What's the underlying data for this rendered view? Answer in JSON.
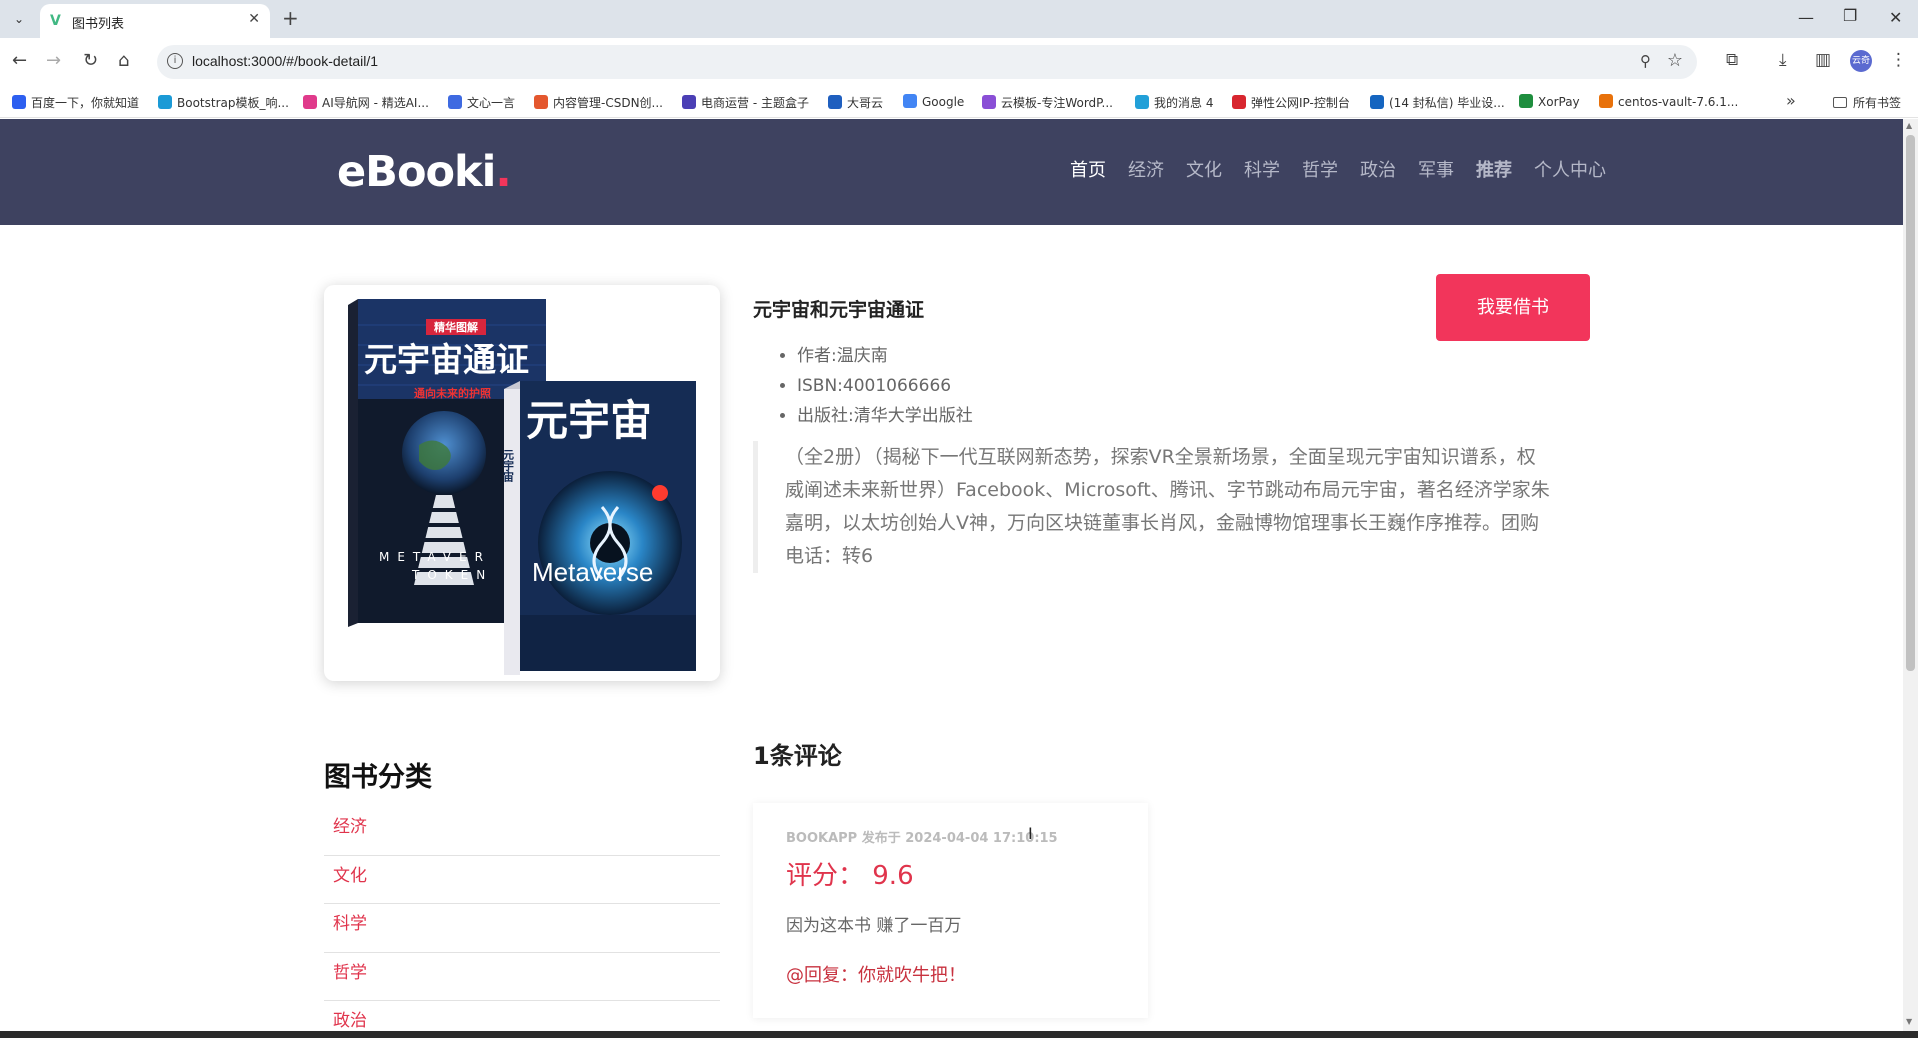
{
  "browser": {
    "tab_title": "图书列表",
    "url": "localhost:3000/#/book-detail/1",
    "profile_label": "云奇",
    "bookmarks": [
      {
        "label": "百度一下，你就知道",
        "color": "#2d5ff0"
      },
      {
        "label": "Bootstrap模板_响...",
        "color": "#1b9ad6"
      },
      {
        "label": "AI导航网 - 精选AI...",
        "color": "#e03a8b"
      },
      {
        "label": "文心一言",
        "color": "#3e6ae1"
      },
      {
        "label": "内容管理-CSDN创...",
        "color": "#e4572e"
      },
      {
        "label": "电商运营 - 主题盒子",
        "color": "#4b3fb5"
      },
      {
        "label": "大哥云",
        "color": "#1f5fbf"
      },
      {
        "label": "Google",
        "color": "#4285f4"
      },
      {
        "label": "云模板-专注WordP...",
        "color": "#8a4fd6"
      },
      {
        "label": "我的消息 4",
        "color": "#22a0d8"
      },
      {
        "label": "弹性公网IP-控制台",
        "color": "#d8262f"
      },
      {
        "label": "(14 封私信) 毕业设...",
        "color": "#1565c0"
      },
      {
        "label": "XorPay",
        "color": "#1e8e3e"
      },
      {
        "label": "centos-vault-7.6.1...",
        "color": "#e8710a"
      }
    ],
    "all_bookmarks_label": "所有书签"
  },
  "site": {
    "logo": "eBooki",
    "logo_dot": ".",
    "nav": [
      "首页",
      "经济",
      "文化",
      "科学",
      "哲学",
      "政治",
      "军事",
      "推荐",
      "个人中心"
    ]
  },
  "book": {
    "title": "元宇宙和元宇宙通证",
    "author": "作者:温庆南",
    "isbn": "ISBN:4001066666",
    "publisher": "出版社:清华大学出版社",
    "borrow_button": "我要借书",
    "description": "（全2册）（揭秘下一代互联网新态势，探索VR全景新场景，全面呈现元宇宙知识谱系，权威阐述未来新世界）Facebook、Microsoft、腾讯、字节跳动布局元宇宙，著名经济学家朱嘉明，以太坊创始人V神，万向区块链董事长肖风，金融博物馆理事长王巍作序推荐。团购电话：转6",
    "cover": {
      "left_book_label": "精华图解",
      "left_book_title": "元宇宙通证",
      "left_book_subtitle": "通向未来的护照",
      "left_book_footer": "METAVERSE TOKEN",
      "right_book_title": "元宇宙",
      "right_book_word": "Metaverse"
    }
  },
  "categories": {
    "title": "图书分类",
    "items": [
      "经济",
      "文化",
      "科学",
      "哲学",
      "政治"
    ]
  },
  "comments": {
    "title": "1条评论",
    "list": [
      {
        "meta": "BOOKAPP 发布于 2024-04-04 17:10:15",
        "score": "评分： 9.6",
        "text": "因为这本书 赚了一百万",
        "reply": "@回复：你就吹牛把！"
      }
    ]
  },
  "colors": {
    "header_bg": "#3e4260",
    "accent": "#f2355b",
    "category_link": "#e0344c"
  }
}
